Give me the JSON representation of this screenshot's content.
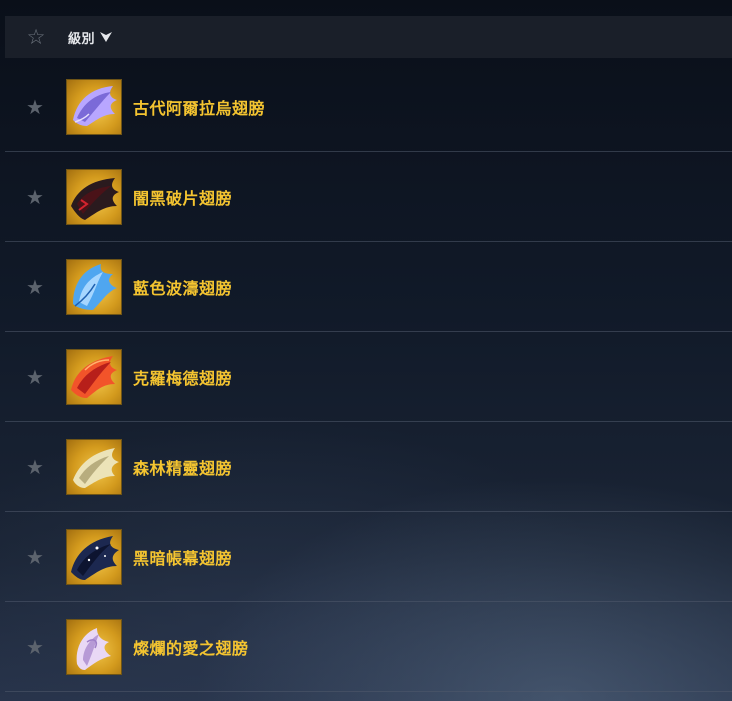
{
  "header": {
    "fav_icon": "star-outline-icon",
    "sort_label": "級別",
    "sort_icon": "caret-down-icon"
  },
  "colors": {
    "item_name": "#f4c430",
    "thumb_bg": "#e0a72a",
    "star": "#5c636d"
  },
  "items": [
    {
      "name": "古代阿爾拉烏翅膀",
      "icon": "ancient-wings-icon",
      "wing_color": "#b8a6ff"
    },
    {
      "name": "闇黑破片翅膀",
      "icon": "dark-shard-wings-icon",
      "wing_color": "#2a1a1e"
    },
    {
      "name": "藍色波濤翅膀",
      "icon": "blue-wave-wings-icon",
      "wing_color": "#4fa6f0"
    },
    {
      "name": "克羅梅德翅膀",
      "icon": "crimson-wings-icon",
      "wing_color": "#f2542a"
    },
    {
      "name": "森林精靈翅膀",
      "icon": "forest-elf-wings-icon",
      "wing_color": "#ece3b8"
    },
    {
      "name": "黑暗帳幕翅膀",
      "icon": "dark-veil-wings-icon",
      "wing_color": "#1c2850"
    },
    {
      "name": "燦爛的愛之翅膀",
      "icon": "brilliant-love-wings-icon",
      "wing_color": "#e9d8f5"
    }
  ]
}
